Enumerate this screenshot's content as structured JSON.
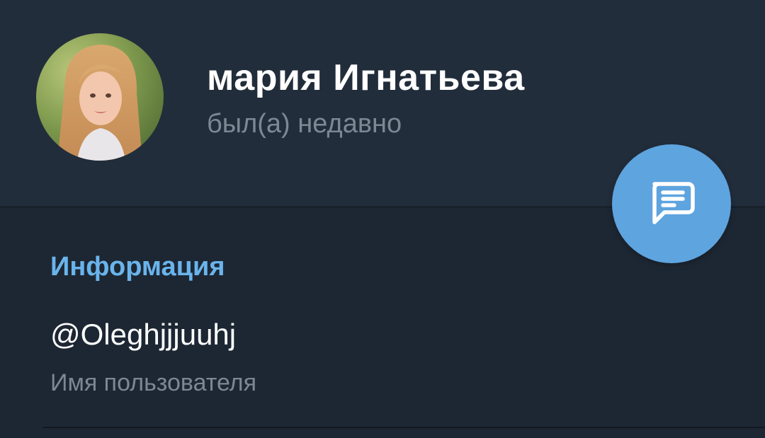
{
  "profile": {
    "name": "мария Игнатьева",
    "status": "был(а) недавно",
    "avatar_icon": "user-photo"
  },
  "fab": {
    "icon": "message-icon",
    "color": "#5ea4df"
  },
  "info_section": {
    "title": "Информация",
    "username_value": "@Oleghjjjuuhj",
    "username_label": "Имя пользователя"
  },
  "colors": {
    "header_bg": "#222d3b",
    "body_bg": "#1d2733",
    "accent": "#6ab4ec",
    "secondary_text": "#7c8894"
  }
}
